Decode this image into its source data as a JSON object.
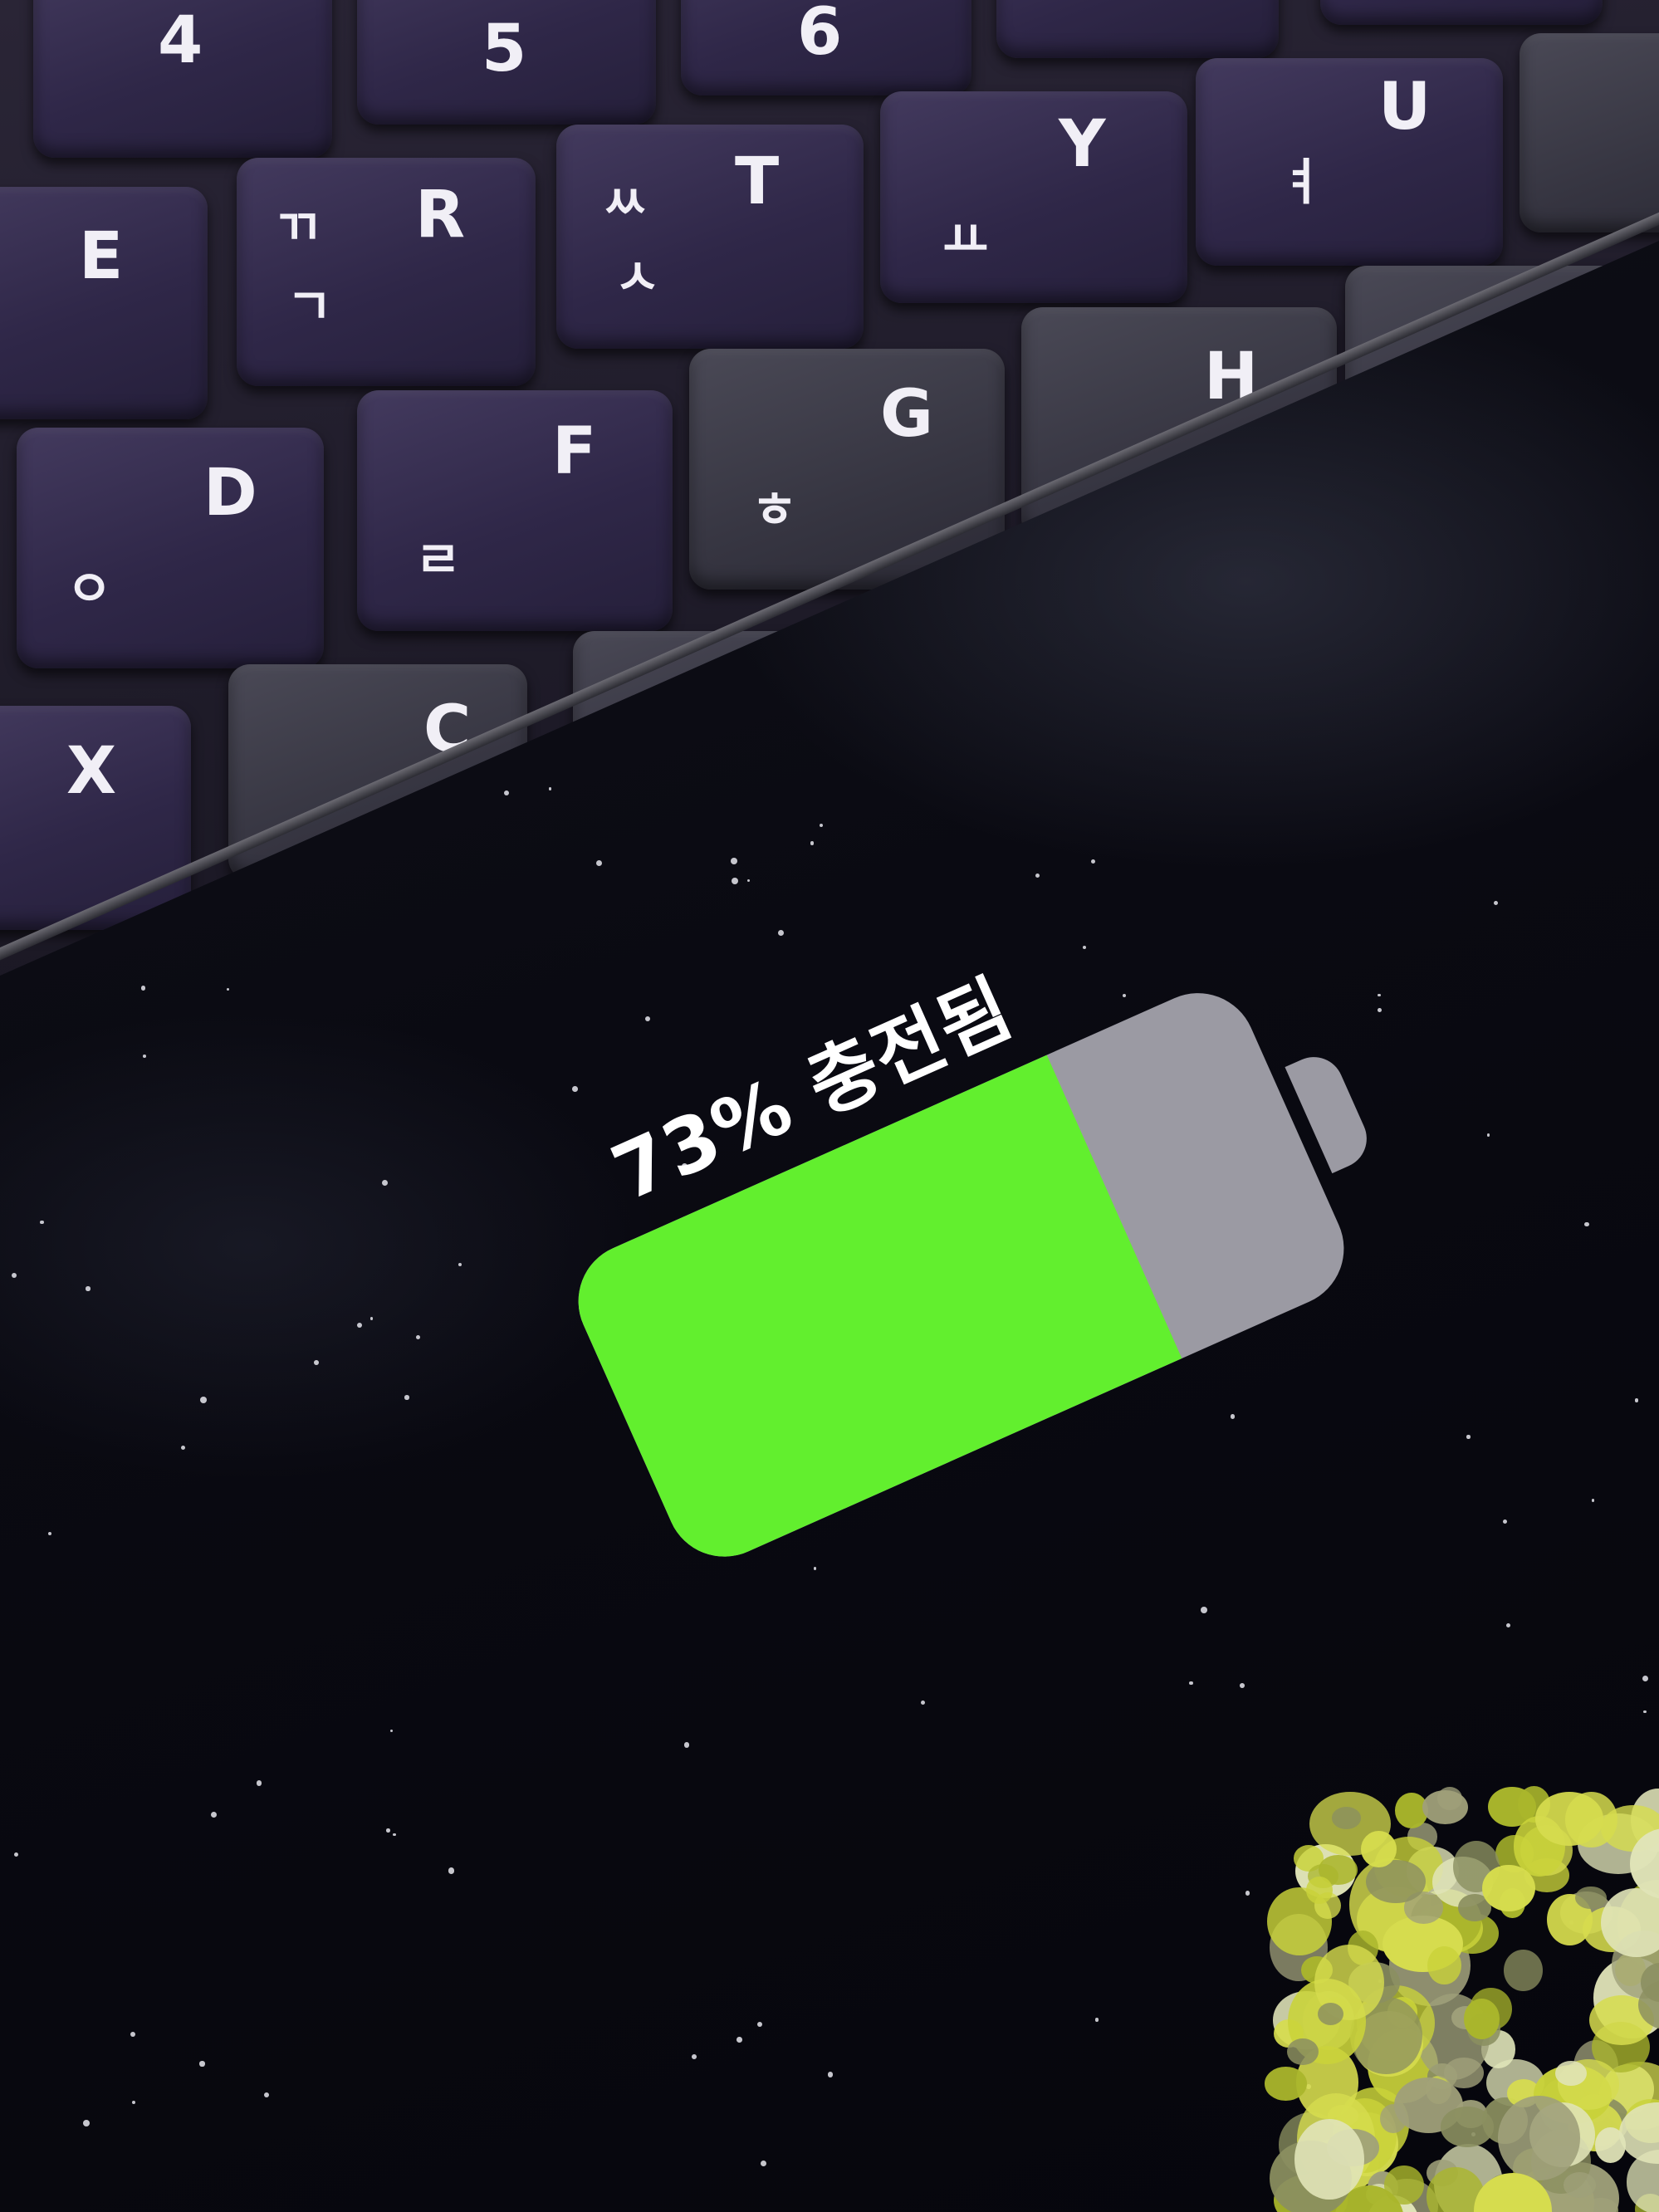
{
  "keyboard": {
    "keys": [
      {
        "main": "4",
        "alt": "$"
      },
      {
        "main": "5",
        "alt": ""
      },
      {
        "main": "6",
        "alt": ""
      },
      {
        "main": "E",
        "alt": ""
      },
      {
        "main": "R",
        "alt": "ㄲ",
        "alt2": "ㄱ"
      },
      {
        "main": "T",
        "alt": "ㅆ",
        "alt2": "ㅅ"
      },
      {
        "main": "Y",
        "alt": "ㅛ"
      },
      {
        "main": "U",
        "alt": "ㅕ"
      },
      {
        "main": "D",
        "alt": "ㅇ"
      },
      {
        "main": "F",
        "alt": "ㄹ"
      },
      {
        "main": "G",
        "alt": "ㅎ"
      },
      {
        "main": "H",
        "alt": ""
      },
      {
        "main": "X",
        "alt": ""
      },
      {
        "main": "C",
        "alt": ""
      }
    ]
  },
  "charging": {
    "label": "73% 충전됨",
    "level_percent": 73,
    "fill_color": "#62ef2e",
    "empty_color": "#9b9aa3"
  }
}
